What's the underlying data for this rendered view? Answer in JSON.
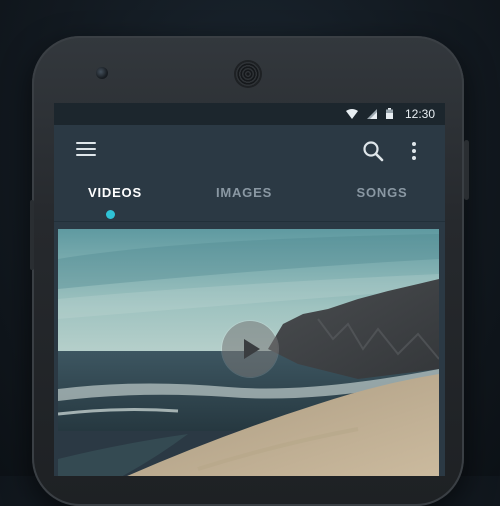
{
  "status_bar": {
    "time": "12:30",
    "icons": [
      "wifi-icon",
      "cellular-signal-icon",
      "battery-icon"
    ]
  },
  "toolbar": {
    "icons": [
      "menu-icon",
      "search-icon",
      "more-vert-icon"
    ]
  },
  "tabs": [
    {
      "label": "VIDEOS",
      "active": true
    },
    {
      "label": "IMAGES",
      "active": false
    },
    {
      "label": "SONGS",
      "active": false
    }
  ],
  "colors": {
    "accent": "#2fc3d6",
    "app_bar": "#2b3944",
    "status_bar": "#1c262d",
    "tab_inactive": "#8a98a3",
    "tab_active": "#ffffff"
  },
  "media": {
    "type": "video-thumbnail",
    "icon": "play-icon"
  }
}
